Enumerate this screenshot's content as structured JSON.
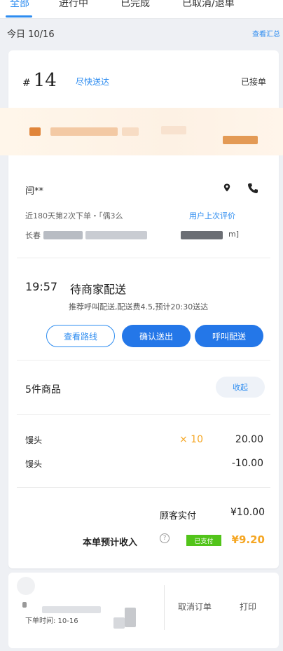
{
  "tabs": [
    {
      "label": "全部",
      "active": true
    },
    {
      "label": "进行中",
      "active": false
    },
    {
      "label": "已完成",
      "active": false
    },
    {
      "label": "已取消/退单",
      "active": false
    }
  ],
  "date_bar": {
    "date": "今日 10/16",
    "summary_link": "查看汇总"
  },
  "order": {
    "hash": "#",
    "number": "14",
    "delivery_tag": "尽快送达",
    "accepted": "已接单",
    "customer_name": "闫**",
    "history": "近180天第2次下单・「偶3么",
    "review_link": "用户上次评价",
    "address_prefix": "长春",
    "address_suffix": "m]",
    "status_time": "19:57",
    "status_text": "待商家配送",
    "delivery_note": "推荐呼叫配送,配送费4.5,预计20:30送达",
    "buttons": {
      "route": "查看路线",
      "confirm": "确认送出",
      "call": "呼叫配送"
    },
    "items_count": "5件商品",
    "collapse": "收起",
    "items": [
      {
        "name": "馒头",
        "qty": "× 10",
        "price": "20.00"
      },
      {
        "name": "馒头",
        "qty": "",
        "price": "-10.00"
      }
    ],
    "customer_paid_label": "顾客实付",
    "customer_paid": "¥10.00",
    "income_label": "本单预计收入",
    "help_icon": "?",
    "paid_badge": "已支付",
    "income": "¥9.20"
  },
  "bottom_card": {
    "order_time": "下单时间: 10-16",
    "cancel": "取消订单",
    "print": "打印"
  },
  "colors": {
    "accent": "#2d8cf0",
    "orange": "#f5a623",
    "green": "#52c41a"
  }
}
